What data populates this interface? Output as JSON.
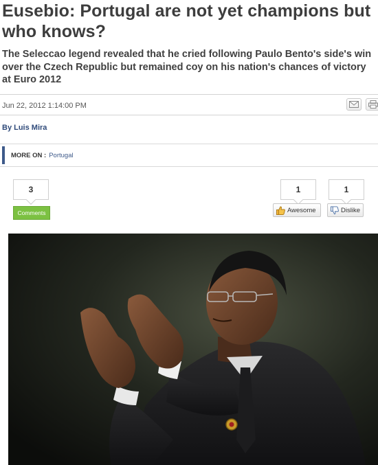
{
  "article": {
    "headline": "Eusebio: Portugal are not yet champions but who knows?",
    "standfirst": "The Seleccao legend revealed that he cried following Paulo Bento's side's win over the Czech Republic but remained coy on his nation's chances of victory at Euro 2012",
    "date": "Jun 22, 2012 1:14:00 PM",
    "byline": "By Luis Mira",
    "more_on_label": "MORE ON :",
    "more_on_tag": "Portugal"
  },
  "social": {
    "comments_count": "3",
    "comments_label": "Comments",
    "awesome_count": "1",
    "awesome_label": "Awesome",
    "dislike_count": "1",
    "dislike_label": "Dislike"
  },
  "share_icons": [
    "email-icon",
    "print-icon"
  ],
  "colors": {
    "headline": "#3d3d3d",
    "link": "#3e5a8a",
    "comments_green": "#7cc142"
  }
}
